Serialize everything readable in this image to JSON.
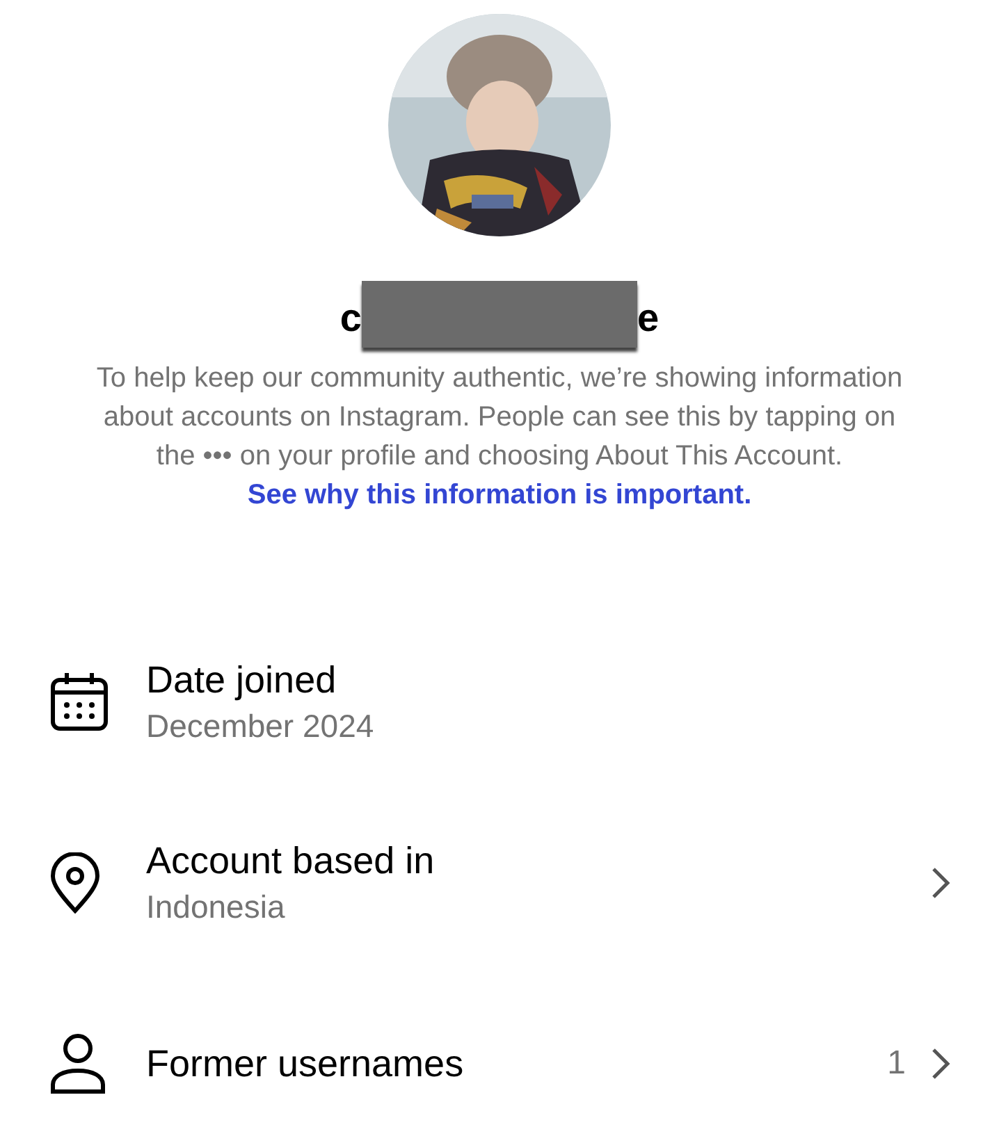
{
  "profile": {
    "username_start": "c",
    "username_end": "e",
    "redacted": true
  },
  "info": {
    "text": "To help keep our community authentic, we’re showing information about accounts on Instagram. People can see this by tapping on the ••• on your profile and choosing About This Account.",
    "link": "See why this information is important."
  },
  "rows": [
    {
      "kind": "calendar",
      "title": "Date joined",
      "subtitle": "December 2024"
    },
    {
      "kind": "location",
      "title": "Account based in",
      "subtitle": "Indonesia",
      "chevron": true
    },
    {
      "kind": "person",
      "title": "Former usernames",
      "count": "1",
      "chevron": true
    }
  ]
}
